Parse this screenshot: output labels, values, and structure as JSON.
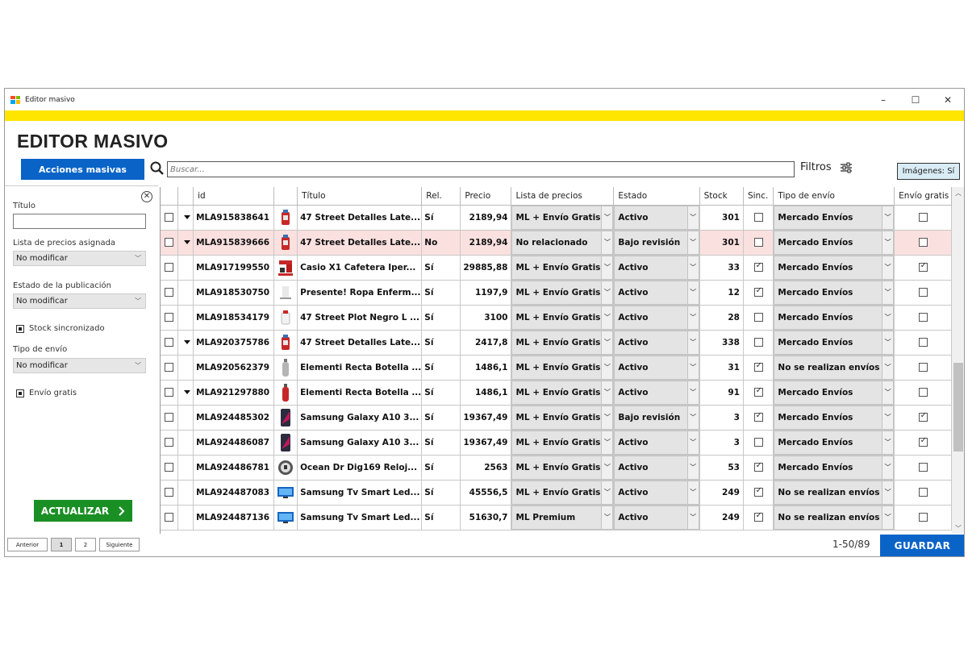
{
  "window": {
    "title": "Editor masivo",
    "minimize": "–",
    "maximize": "☐",
    "close": "✕"
  },
  "header": {
    "title": "EDITOR MASIVO"
  },
  "toolbar": {
    "acciones_label": "Acciones masivas",
    "search_placeholder": "Buscar...",
    "filtros_label": "Filtros",
    "imagenes_label": "Imágenes: Sí"
  },
  "sidebar": {
    "titulo_label": "Título",
    "lista_label": "Lista de precios asignada",
    "lista_value": "No modificar",
    "estado_label": "Estado de la publicación",
    "estado_value": "No modificar",
    "stock_sync_label": "Stock sincronizado",
    "envio_label": "Tipo de envío",
    "envio_value": "No modificar",
    "envio_gratis_label": "Envío gratis",
    "actualizar_label": "ACTUALIZAR"
  },
  "pager": {
    "prev": "Anterior",
    "pages": [
      "1",
      "2"
    ],
    "next": "Siguiente"
  },
  "table": {
    "columns": [
      "id",
      "Título",
      "Rel.",
      "Precio",
      "Lista de precios",
      "Estado",
      "Stock",
      "Sinc.",
      "Tipo de envío",
      "Envío gratis"
    ],
    "rows": [
      {
        "expand": true,
        "id": "MLA915838641",
        "thumb": "red-bag",
        "titulo": "47 Street Detalles Late...",
        "rel": "Sí",
        "precio": "2189,94",
        "lista": "ML + Envío Gratis",
        "estado": "Activo",
        "stock": "301",
        "sinc": false,
        "envio": "Mercado Envíos",
        "gratis": false,
        "highlight": false
      },
      {
        "expand": true,
        "id": "MLA915839666",
        "thumb": "red-bag",
        "titulo": "47 Street Detalles Late...",
        "rel": "No",
        "precio": "2189,94",
        "lista": "No relacionado",
        "estado": "Bajo revisión",
        "stock": "301",
        "sinc": false,
        "envio": "Mercado Envíos",
        "gratis": false,
        "highlight": true
      },
      {
        "expand": false,
        "id": "MLA917199550",
        "thumb": "coffee",
        "titulo": "Casio X1 Cafetera Iper...",
        "rel": "Sí",
        "precio": "29885,88",
        "lista": "ML + Envío Gratis",
        "estado": "Activo",
        "stock": "33",
        "sinc": true,
        "envio": "Mercado Envíos",
        "gratis": true,
        "highlight": false
      },
      {
        "expand": false,
        "id": "MLA918530750",
        "thumb": "clothes",
        "titulo": "Presente! Ropa Enferm...",
        "rel": "Sí",
        "precio": "1197,9",
        "lista": "ML + Envío Gratis",
        "estado": "Activo",
        "stock": "12",
        "sinc": true,
        "envio": "Mercado Envíos",
        "gratis": false,
        "highlight": false
      },
      {
        "expand": false,
        "id": "MLA918534179",
        "thumb": "bag-white",
        "titulo": "47 Street Plot Negro L ...",
        "rel": "Sí",
        "precio": "3100",
        "lista": "ML + Envío Gratis",
        "estado": "Activo",
        "stock": "28",
        "sinc": false,
        "envio": "Mercado Envíos",
        "gratis": false,
        "highlight": false
      },
      {
        "expand": true,
        "id": "MLA920375786",
        "thumb": "red-bag",
        "titulo": "47 Street Detalles Late...",
        "rel": "Sí",
        "precio": "2417,8",
        "lista": "ML + Envío Gratis",
        "estado": "Activo",
        "stock": "338",
        "sinc": false,
        "envio": "Mercado Envíos",
        "gratis": false,
        "highlight": false
      },
      {
        "expand": false,
        "id": "MLA920562379",
        "thumb": "bottle-grey",
        "titulo": "Elementi Recta Botella ...",
        "rel": "Sí",
        "precio": "1486,1",
        "lista": "ML + Envío Gratis",
        "estado": "Activo",
        "stock": "31",
        "sinc": true,
        "envio": "No se realizan envíos",
        "gratis": false,
        "highlight": false
      },
      {
        "expand": true,
        "id": "MLA921297880",
        "thumb": "bottle-red",
        "titulo": "Elementi Recta Botella ...",
        "rel": "Sí",
        "precio": "1486,1",
        "lista": "ML + Envío Gratis",
        "estado": "Activo",
        "stock": "91",
        "sinc": true,
        "envio": "Mercado Envíos",
        "gratis": false,
        "highlight": false
      },
      {
        "expand": false,
        "id": "MLA924485302",
        "thumb": "phone",
        "titulo": "Samsung Galaxy A10 3...",
        "rel": "Sí",
        "precio": "19367,49",
        "lista": "ML + Envío Gratis",
        "estado": "Bajo revisión",
        "stock": "3",
        "sinc": true,
        "envio": "Mercado Envíos",
        "gratis": true,
        "highlight": false
      },
      {
        "expand": false,
        "id": "MLA924486087",
        "thumb": "phone",
        "titulo": "Samsung Galaxy A10 3...",
        "rel": "Sí",
        "precio": "19367,49",
        "lista": "ML + Envío Gratis",
        "estado": "Activo",
        "stock": "3",
        "sinc": false,
        "envio": "Mercado Envíos",
        "gratis": true,
        "highlight": false
      },
      {
        "expand": false,
        "id": "MLA924486781",
        "thumb": "watch",
        "titulo": "Ocean Dr Dig169 Reloj...",
        "rel": "Sí",
        "precio": "2563",
        "lista": "ML + Envío Gratis",
        "estado": "Activo",
        "stock": "53",
        "sinc": true,
        "envio": "Mercado Envíos",
        "gratis": false,
        "highlight": false
      },
      {
        "expand": false,
        "id": "MLA924487083",
        "thumb": "tv",
        "titulo": "Samsung Tv Smart Led...",
        "rel": "Sí",
        "precio": "45556,5",
        "lista": "ML + Envío Gratis",
        "estado": "Activo",
        "stock": "249",
        "sinc": true,
        "envio": "No se realizan envíos",
        "gratis": false,
        "highlight": false
      },
      {
        "expand": false,
        "id": "MLA924487136",
        "thumb": "tv",
        "titulo": "Samsung Tv Smart Led...",
        "rel": "Sí",
        "precio": "51630,7",
        "lista": "ML Premium",
        "estado": "Activo",
        "stock": "249",
        "sinc": true,
        "envio": "No se realizan envíos",
        "gratis": false,
        "highlight": false
      }
    ]
  },
  "footer": {
    "count": "1-50/89",
    "guardar_label": "GUARDAR"
  },
  "colors": {
    "accent_blue": "#0a64c8",
    "accent_green": "#1a8f24",
    "brand_yellow": "#ffe600",
    "highlight_row": "#fbe0e0"
  }
}
